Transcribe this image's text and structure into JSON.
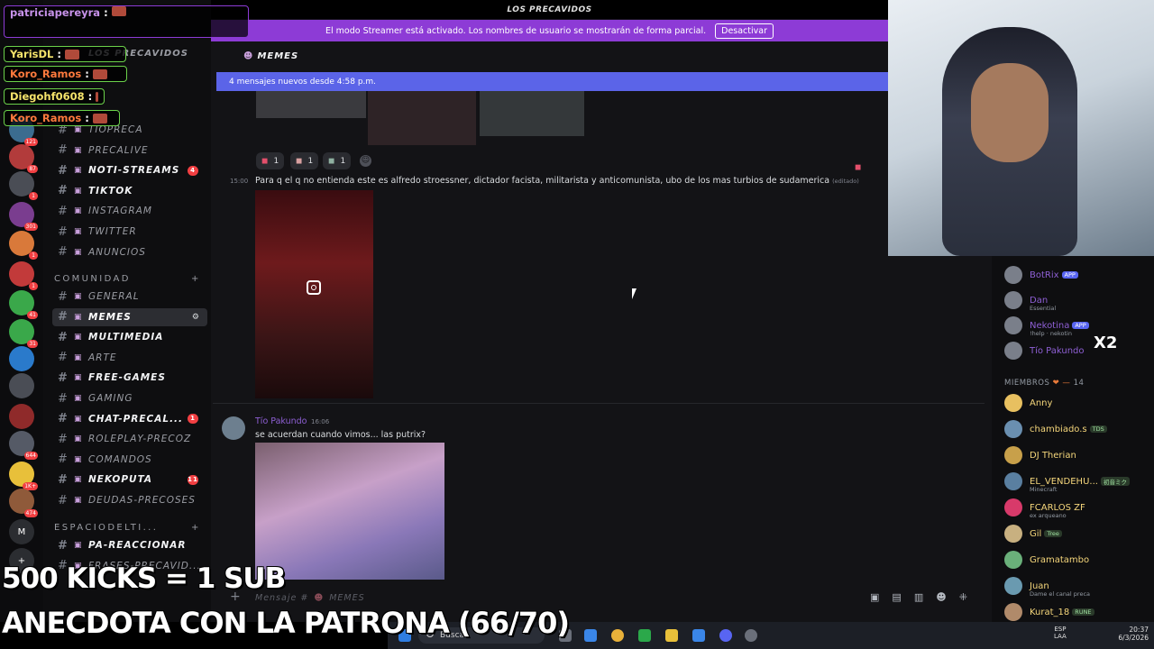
{
  "window": {
    "server_title": "LOS PRECAVIDOS",
    "streamer_notice": "El modo Streamer está activado. Los nombres de usuario se mostrarán de forma parcial.",
    "streamer_button": "Desactivar",
    "channel_header": "MEMES",
    "new_messages_bar": "4 mensajes nuevos desde 4:58 p.m."
  },
  "server_rail": [
    {
      "badge": "121"
    },
    {
      "badge": "87"
    },
    {
      "badge": "1"
    },
    {
      "badge": "301"
    },
    {
      "badge": "1"
    },
    {
      "badge": "1"
    },
    {
      "badge": "41"
    },
    {
      "badge": "31"
    },
    {
      "badge": ""
    },
    {
      "badge": ""
    },
    {
      "badge": ""
    },
    {
      "badge": "644"
    },
    {
      "badge": "1K+"
    },
    {
      "badge": "474"
    },
    {
      "label": "M",
      "badge": ""
    },
    {
      "label": "+",
      "badge": ""
    }
  ],
  "sidebar": {
    "server_name": "LOS PRECAVIDOS",
    "channels": [
      {
        "name": "TIOPRECA",
        "state": "normal"
      },
      {
        "name": "PRECALIVE",
        "state": "normal"
      },
      {
        "name": "NOTI-STREAMS",
        "state": "unread",
        "count": "4"
      },
      {
        "name": "TIKTOK",
        "state": "unread"
      },
      {
        "name": "INSTAGRAM",
        "state": "normal"
      },
      {
        "name": "TWITTER",
        "state": "normal"
      },
      {
        "name": "ANUNCIOS",
        "state": "normal"
      }
    ],
    "category_comunidad": "COMUNIDAD",
    "channels2": [
      {
        "name": "GENERAL",
        "state": "normal"
      },
      {
        "name": "MEMES",
        "state": "active"
      },
      {
        "name": "MULTIMEDIA",
        "state": "unread"
      },
      {
        "name": "ARTE",
        "state": "normal"
      },
      {
        "name": "FREE-GAMES",
        "state": "unread"
      },
      {
        "name": "GAMING",
        "state": "normal"
      },
      {
        "name": "CHAT-PRECAL...",
        "state": "unread",
        "count": "1"
      },
      {
        "name": "ROLEPLAY-PRECOZ",
        "state": "normal"
      },
      {
        "name": "COMANDOS",
        "state": "normal"
      },
      {
        "name": "NEKOPUTA",
        "state": "unread",
        "count": "11"
      },
      {
        "name": "DEUDAS-PRECOSES",
        "state": "normal"
      }
    ],
    "category_espacio": "ESPACIODELTI...",
    "channels3": [
      {
        "name": "PA-REACCIONAR",
        "state": "unread"
      },
      {
        "name": "FRASES-PRECAVID...",
        "state": "normal"
      }
    ]
  },
  "stream_chat": [
    {
      "user": "patriciapereyra",
      "color": "#c792ea"
    },
    {
      "user": "YarisDL",
      "color": "#f5e36b"
    },
    {
      "user": "Koro_Ramos",
      "color": "#ff7a3d"
    },
    {
      "user": "Diegohf0608",
      "color": "#f5e36b"
    },
    {
      "user": "Koro_Ramos",
      "color": "#ff7a3d"
    }
  ],
  "messages": {
    "reactions": [
      "1",
      "1",
      "1"
    ],
    "msg1_time": "15:00",
    "msg1_text": "Para q el q no entienda este es alfredo stroessner, dictador facista, militarista y anticomunista, ubo de los mas turbios de sudamerica",
    "msg1_edited": "(editado)",
    "msg2_author": "Tío Pakundo",
    "msg2_time": "16:06",
    "msg2_text": "se acuerdan cuando vimos... las putrix?"
  },
  "input": {
    "placeholder": "Mensaje #",
    "channel": "MEMES"
  },
  "members": {
    "bots": [
      {
        "name": "BotRix",
        "tag": "APP",
        "color": "#8e5fd4"
      },
      {
        "name": "Dan",
        "sub": "Essential",
        "color": "#8e5fd4"
      },
      {
        "name": "Nekotina",
        "sub": "!help · nekotin",
        "tag": "APP",
        "color": "#8e5fd4"
      },
      {
        "name": "Tío Pakundo",
        "color": "#8e5fd4"
      }
    ],
    "section_title": "MIEMBROS",
    "section_count": "14",
    "list": [
      {
        "name": "Anny",
        "color": "#f5d67b"
      },
      {
        "name": "chambiado.s",
        "tag": "TDS",
        "color": "#f5d67b"
      },
      {
        "name": "DJ Therian",
        "color": "#f5d67b"
      },
      {
        "name": "EL_VENDEHU...",
        "sub": "Minecraft",
        "tag": "初音ミク",
        "color": "#f5d67b"
      },
      {
        "name": "FCARLOS ZF",
        "sub": "ex arqueano",
        "color": "#f5d67b"
      },
      {
        "name": "Gil",
        "tag": "Tree",
        "color": "#f5d67b"
      },
      {
        "name": "Gramatambo",
        "color": "#f5d67b"
      },
      {
        "name": "Juan",
        "sub": "Dame el canal preca",
        "color": "#f5d67b"
      },
      {
        "name": "Kurat_18",
        "tag": "RUNE",
        "color": "#f5d67b"
      }
    ]
  },
  "cam_overlay": "X2",
  "stream_overlay": {
    "line1": "500 KICKS = 1 SUB",
    "line2": "ANECDOTA CON LA PATRONA (66/70)"
  },
  "taskbar": {
    "search": "Buscar",
    "lang": "ESP",
    "lang2": "LAA",
    "time": "20:37",
    "date": "6/3/2026"
  },
  "colors": {
    "accent": "#5865f2",
    "streamer_bar": "#8d3bd6",
    "unread_badge": "#f23f42"
  }
}
